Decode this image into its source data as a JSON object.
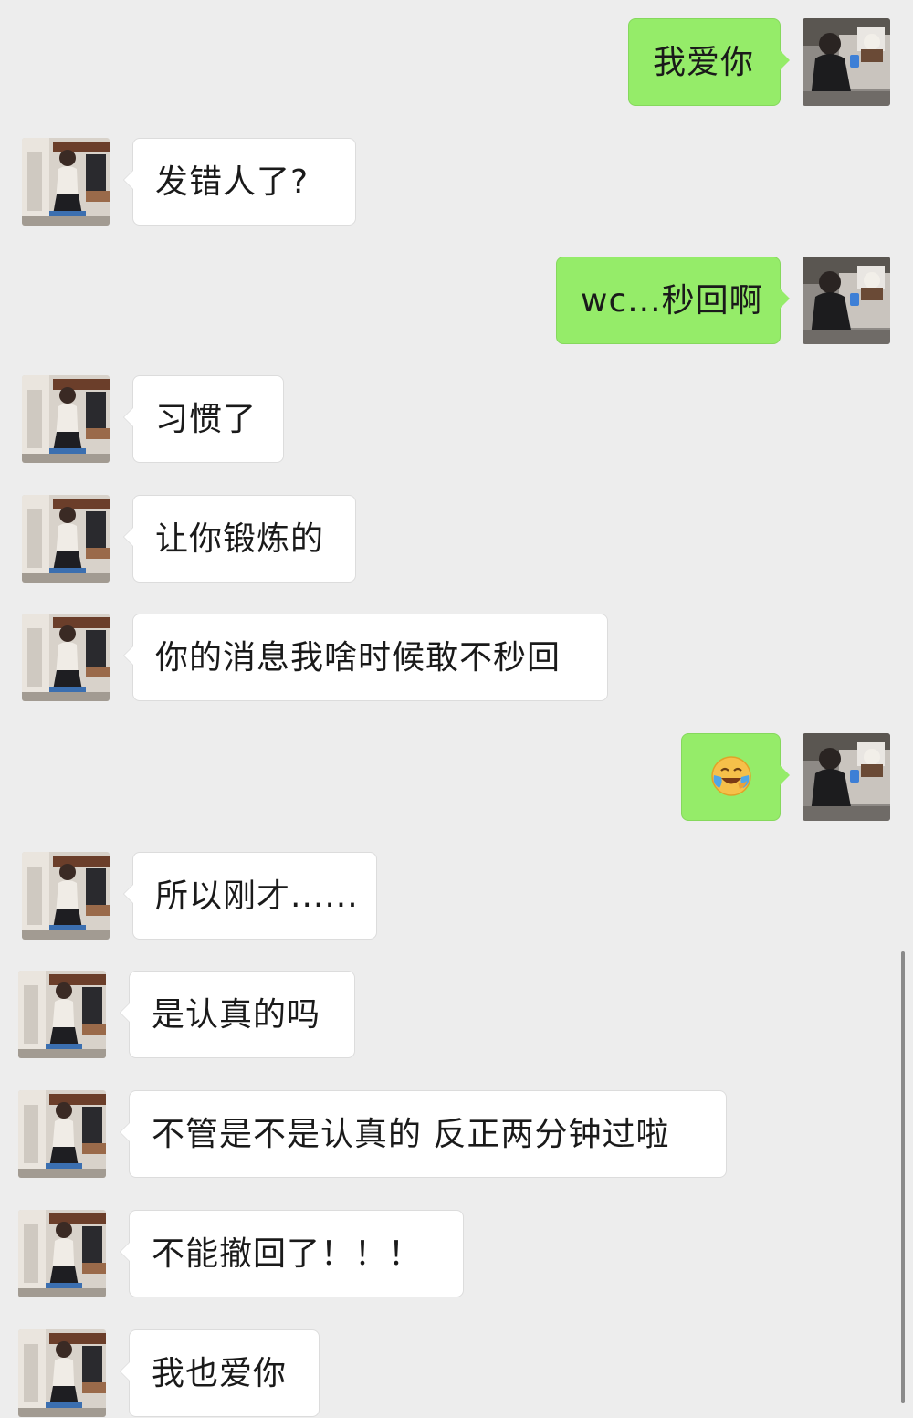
{
  "messages": [
    {
      "side": "right",
      "text": "我爱你"
    },
    {
      "side": "left",
      "text": "发错人了?"
    },
    {
      "side": "right",
      "text": "wc...秒回啊"
    },
    {
      "side": "left",
      "text": "习惯了"
    },
    {
      "side": "left",
      "text": "让你锻炼的"
    },
    {
      "side": "left",
      "text": "你的消息我啥时候敢不秒回"
    },
    {
      "side": "right",
      "emoji": "crying-laughing-emoji"
    },
    {
      "side": "left",
      "text": "所以刚才......"
    },
    {
      "side": "left",
      "text": "是认真的吗"
    },
    {
      "side": "left",
      "text": "不管是不是认真的 反正两分钟过啦"
    },
    {
      "side": "left",
      "text": "不能撤回了！！！"
    },
    {
      "side": "left",
      "text": "我也爱你"
    }
  ],
  "colors": {
    "background": "#ededed",
    "sent_bubble": "#95ec69",
    "received_bubble": "#ffffff"
  }
}
